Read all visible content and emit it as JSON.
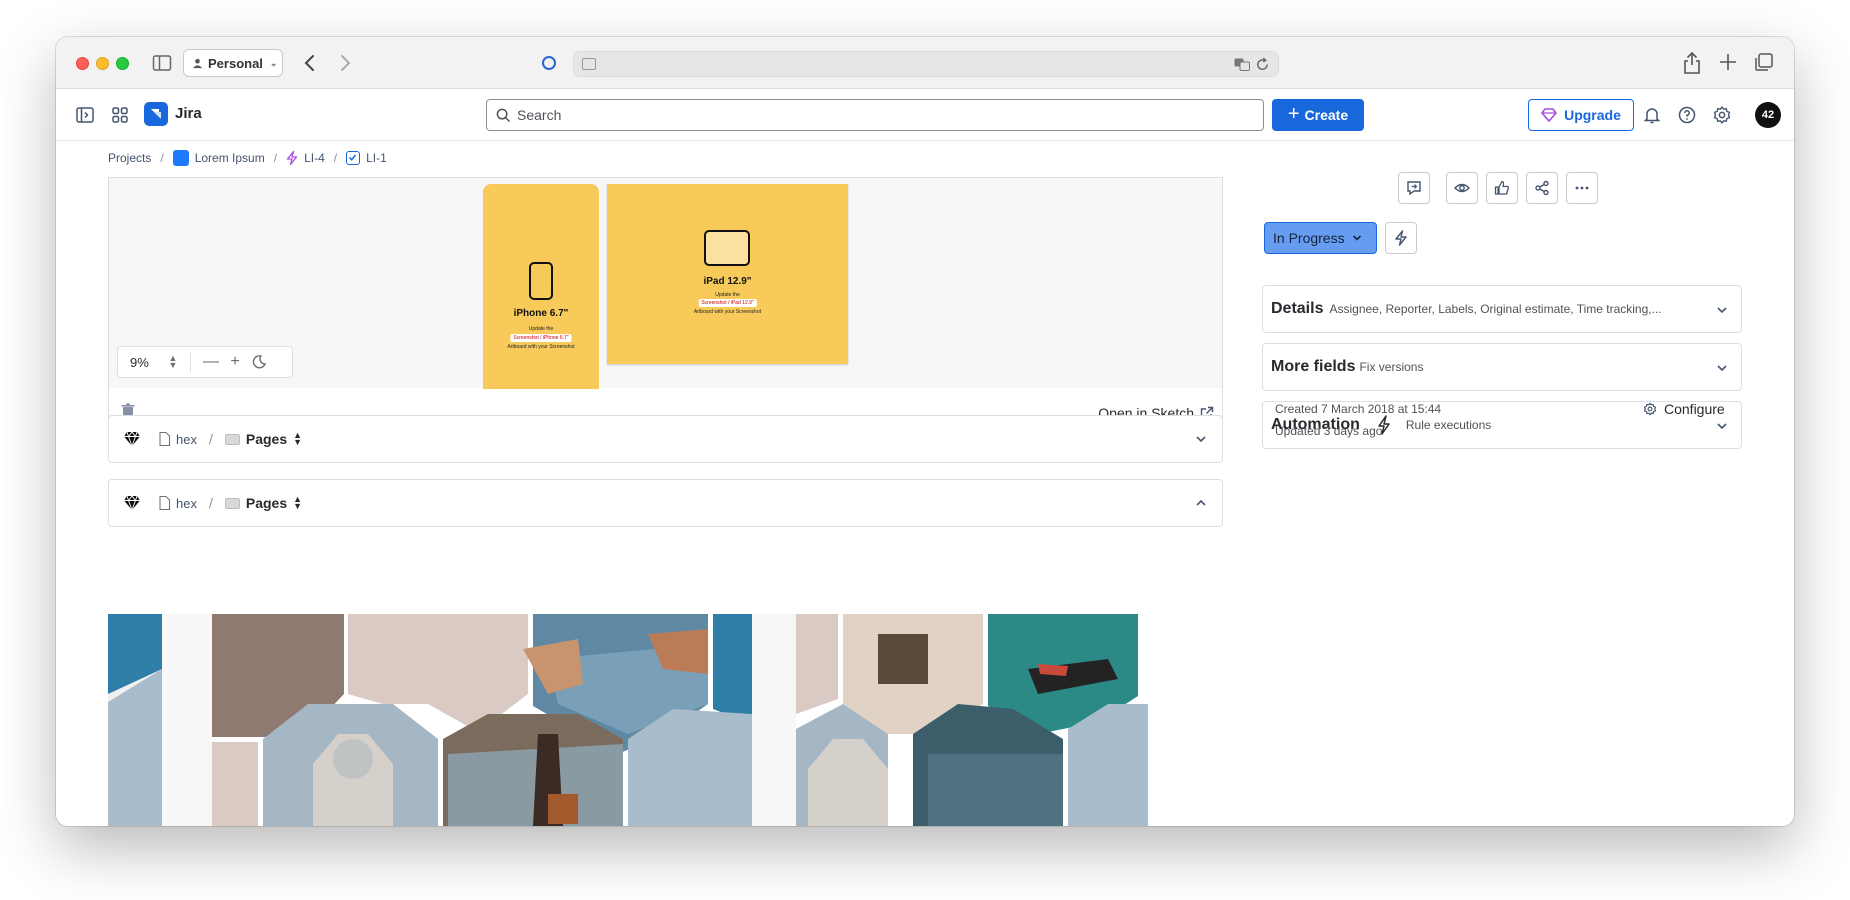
{
  "browser": {
    "profile_label": "Personal"
  },
  "jira": {
    "app_name": "Jira",
    "search_placeholder": "Search",
    "create_label": "Create",
    "upgrade_label": "Upgrade",
    "avatar_initials": "42"
  },
  "breadcrumb": {
    "items": [
      "Projects",
      "Lorem Ipsum",
      "LI-4",
      "LI-1"
    ],
    "separator": "/"
  },
  "attachment_preview": {
    "zoom_value": "9%",
    "open_label": "Open in Sketch",
    "iphone_title": "iPhone 6.7\"",
    "iphone_line1": "Update the",
    "iphone_chip": "Screenshot / iPhone 6.7\"",
    "iphone_line2": "Artboard with your Screenshot",
    "ipad_title": "iPad 12.9\"",
    "ipad_line1": "Update the",
    "ipad_chip": "Screenshot / iPad 12.9\"",
    "ipad_line2": "Artboard with your Screenshot"
  },
  "sketch_rows": [
    {
      "file": "hex",
      "pages_label": "Pages",
      "expanded": false
    },
    {
      "file": "hex",
      "pages_label": "Pages",
      "expanded": true
    }
  ],
  "issue_panel": {
    "status": "In Progress",
    "details_title": "Details",
    "details_sub": "Assignee, Reporter, Labels, Original estimate, Time tracking,...",
    "more_fields_title": "More fields",
    "more_fields_sub": "Fix versions",
    "automation_title": "Automation",
    "automation_sub": "Rule executions",
    "created": "Created 7 March 2018 at 15:44",
    "updated": "Updated 3 days ago",
    "configure_label": "Configure"
  },
  "colors": {
    "brand_blue": "#1868db",
    "status_blue": "#669df1",
    "card_yellow": "#f8ca5a"
  },
  "icons": [
    "sidebar-icon",
    "person-icon",
    "chevron-left-icon",
    "chevron-right-icon",
    "shield-icon",
    "translate-icon",
    "reload-icon",
    "share-icon",
    "plus-icon",
    "tabs-icon",
    "app-switcher-icon",
    "search-icon",
    "gem-icon",
    "bell-icon",
    "help-icon",
    "gear-icon",
    "feedback-icon",
    "eye-icon",
    "thumbs-up-icon",
    "ellipsis-icon",
    "bolt-icon",
    "trash-icon",
    "external-link-icon",
    "sketch-icon",
    "file-icon",
    "folder-icon",
    "chevron-down-icon",
    "chevron-up-icon"
  ]
}
